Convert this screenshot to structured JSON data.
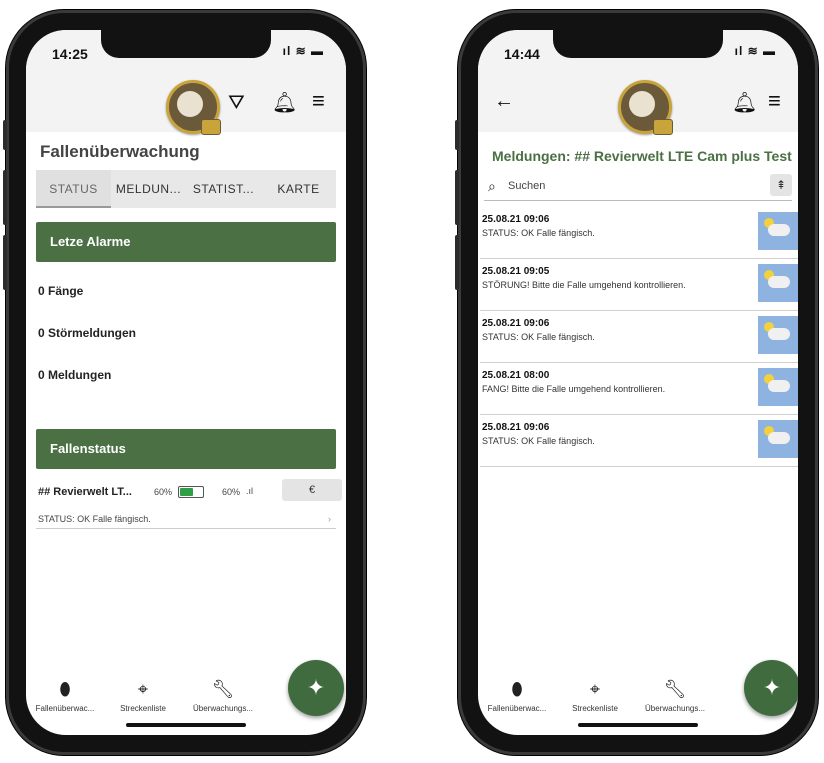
{
  "left": {
    "time": "14:25",
    "title": "Fallenüberwachung",
    "tabs": [
      "STATUS",
      "MELDUN...",
      "STATIST...",
      "KARTE"
    ],
    "section_alarms": "Letze Alarme",
    "counts": [
      "0 Fänge",
      "0 Störmeldungen",
      "0 Meldungen"
    ],
    "section_status": "Fallenstatus",
    "trap": {
      "name": "## Revierwelt LT...",
      "battery_pct": "60%",
      "battery_level": 0.6,
      "signal_pct": "60%",
      "euro": "€",
      "status": "STATUS: OK Falle fängisch."
    },
    "nav": [
      "Fallenüberwac...",
      "Streckenliste",
      "Überwachungs..."
    ]
  },
  "right": {
    "time": "14:44",
    "title": "Meldungen: ## Revierwelt LTE Cam plus Test",
    "search_placeholder": "Suchen",
    "messages": [
      {
        "date": "25.08.21 09:06",
        "text": "STATUS: OK Falle fängisch."
      },
      {
        "date": "25.08.21 09:05",
        "text": "STÖRUNG! Bitte die Falle umgehend kontrollieren."
      },
      {
        "date": "25.08.21 09:06",
        "text": "STATUS: OK Falle fängisch."
      },
      {
        "date": "25.08.21 08:00",
        "text": "FANG! Bitte die Falle umgehend kontrollieren."
      },
      {
        "date": "25.08.21 09:06",
        "text": "STATUS: OK Falle fängisch."
      }
    ],
    "nav": [
      "Fallenüberwac...",
      "Streckenliste",
      "Überwachungs..."
    ]
  },
  "colors": {
    "accent_green": "#4a7043",
    "fab_green": "#3f6b3f"
  }
}
